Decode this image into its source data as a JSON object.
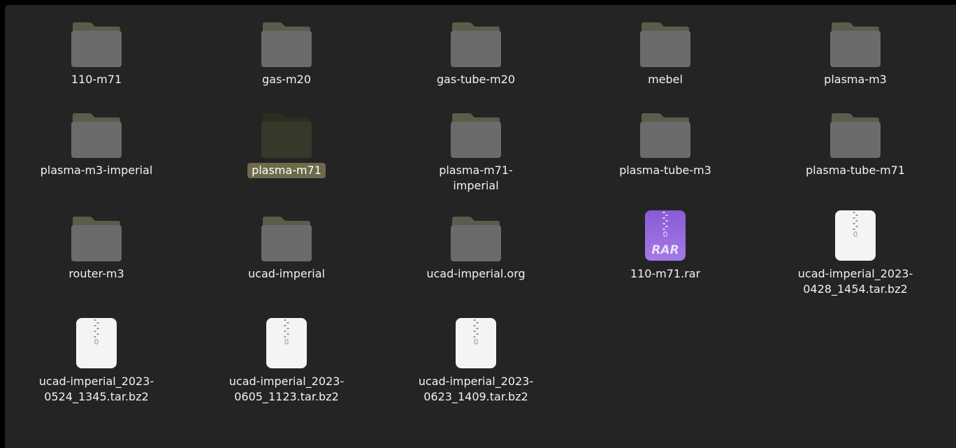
{
  "colors": {
    "background": "#242424",
    "folder_body": "#6b6b6b",
    "folder_tab": "#5a5d4a",
    "folder_selected_body": "#36392a",
    "folder_selected_tab": "#2b2e20",
    "selection_label": "#6d6a4a",
    "rar_accent": "#8a5bd6"
  },
  "files": [
    {
      "name": "110-m71",
      "type": "folder",
      "icon": "folder-icon",
      "selected": false
    },
    {
      "name": "gas-m20",
      "type": "folder",
      "icon": "folder-icon",
      "selected": false
    },
    {
      "name": "gas-tube-m20",
      "type": "folder",
      "icon": "folder-icon",
      "selected": false
    },
    {
      "name": "mebel",
      "type": "folder",
      "icon": "folder-icon",
      "selected": false
    },
    {
      "name": "plasma-m3",
      "type": "folder",
      "icon": "folder-icon",
      "selected": false
    },
    {
      "name": "plasma-m3-imperial",
      "type": "folder",
      "icon": "folder-icon",
      "selected": false
    },
    {
      "name": "plasma-m71",
      "type": "folder",
      "icon": "folder-icon",
      "selected": true
    },
    {
      "name": "plasma-m71-\nimperial",
      "type": "folder",
      "icon": "folder-icon",
      "selected": false
    },
    {
      "name": "plasma-tube-m3",
      "type": "folder",
      "icon": "folder-icon",
      "selected": false
    },
    {
      "name": "plasma-tube-m71",
      "type": "folder",
      "icon": "folder-icon",
      "selected": false
    },
    {
      "name": "router-m3",
      "type": "folder",
      "icon": "folder-icon",
      "selected": false
    },
    {
      "name": "ucad-imperial",
      "type": "folder",
      "icon": "folder-icon",
      "selected": false
    },
    {
      "name": "ucad-imperial.org",
      "type": "folder",
      "icon": "folder-icon",
      "selected": false
    },
    {
      "name": "110-m71.rar",
      "type": "rar",
      "icon": "rar-archive-icon",
      "icon_text": "RAR",
      "selected": false
    },
    {
      "name": "ucad-imperial_2023-\n0428_1454.tar.bz2",
      "type": "archive",
      "icon": "archive-icon",
      "selected": false
    },
    {
      "name": "ucad-imperial_2023-\n0524_1345.tar.bz2",
      "type": "archive",
      "icon": "archive-icon",
      "selected": false
    },
    {
      "name": "ucad-imperial_2023-\n0605_1123.tar.bz2",
      "type": "archive",
      "icon": "archive-icon",
      "selected": false
    },
    {
      "name": "ucad-imperial_2023-\n0623_1409.tar.bz2",
      "type": "archive",
      "icon": "archive-icon",
      "selected": false
    }
  ]
}
